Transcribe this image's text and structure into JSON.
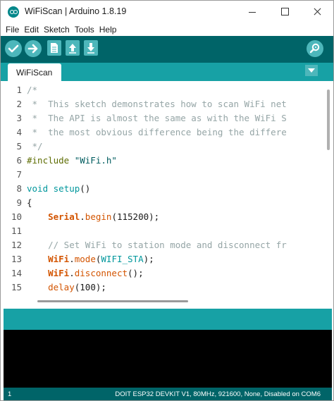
{
  "window": {
    "title": "WiFiScan | Arduino 1.8.19"
  },
  "menu": [
    "File",
    "Edit",
    "Sketch",
    "Tools",
    "Help"
  ],
  "toolbar": {
    "verify": "check-icon",
    "upload": "arrow-right-icon",
    "new": "document-icon",
    "open": "arrow-up-icon",
    "save": "arrow-down-icon",
    "serial_monitor": "magnifier-icon"
  },
  "tabs": [
    {
      "label": "WiFiScan"
    }
  ],
  "editor": {
    "lines": [
      {
        "n": "1",
        "segs": [
          {
            "t": "/*",
            "c": "c-comment"
          }
        ]
      },
      {
        "n": "2",
        "segs": [
          {
            "t": " *  This sketch demonstrates how to scan WiFi net",
            "c": "c-comment"
          }
        ]
      },
      {
        "n": "3",
        "segs": [
          {
            "t": " *  The API is almost the same as with the WiFi S",
            "c": "c-comment"
          }
        ]
      },
      {
        "n": "4",
        "segs": [
          {
            "t": " *  the most obvious difference being the differe",
            "c": "c-comment"
          }
        ]
      },
      {
        "n": "5",
        "segs": [
          {
            "t": " */",
            "c": "c-comment"
          }
        ]
      },
      {
        "n": "6",
        "segs": [
          {
            "t": "#include ",
            "c": "c-pre"
          },
          {
            "t": "\"WiFi.h\"",
            "c": "c-str"
          }
        ]
      },
      {
        "n": "7",
        "segs": []
      },
      {
        "n": "8",
        "segs": [
          {
            "t": "void",
            "c": "c-kw"
          },
          {
            "t": " ",
            "c": ""
          },
          {
            "t": "setup",
            "c": "c-kw"
          },
          {
            "t": "()",
            "c": ""
          }
        ]
      },
      {
        "n": "9",
        "segs": [
          {
            "t": "{",
            "c": ""
          }
        ]
      },
      {
        "n": "10",
        "segs": [
          {
            "t": "    ",
            "c": ""
          },
          {
            "t": "Serial",
            "c": "c-obj"
          },
          {
            "t": ".",
            "c": ""
          },
          {
            "t": "begin",
            "c": "c-fn"
          },
          {
            "t": "(115200);",
            "c": ""
          }
        ]
      },
      {
        "n": "11",
        "segs": []
      },
      {
        "n": "12",
        "segs": [
          {
            "t": "    // Set WiFi to station mode and disconnect fr",
            "c": "c-comment"
          }
        ]
      },
      {
        "n": "13",
        "segs": [
          {
            "t": "    ",
            "c": ""
          },
          {
            "t": "WiFi",
            "c": "c-obj"
          },
          {
            "t": ".",
            "c": ""
          },
          {
            "t": "mode",
            "c": "c-fn"
          },
          {
            "t": "(",
            "c": ""
          },
          {
            "t": "WIFI_STA",
            "c": "c-const"
          },
          {
            "t": ");",
            "c": ""
          }
        ]
      },
      {
        "n": "14",
        "segs": [
          {
            "t": "    ",
            "c": ""
          },
          {
            "t": "WiFi",
            "c": "c-obj"
          },
          {
            "t": ".",
            "c": ""
          },
          {
            "t": "disconnect",
            "c": "c-fn"
          },
          {
            "t": "();",
            "c": ""
          }
        ]
      },
      {
        "n": "15",
        "segs": [
          {
            "t": "    ",
            "c": ""
          },
          {
            "t": "delay",
            "c": "c-fn"
          },
          {
            "t": "(100);",
            "c": ""
          }
        ]
      }
    ]
  },
  "status": {
    "line": "1",
    "board": "DOIT ESP32 DEVKIT V1, 80MHz, 921600, None, Disabled on COM6"
  }
}
